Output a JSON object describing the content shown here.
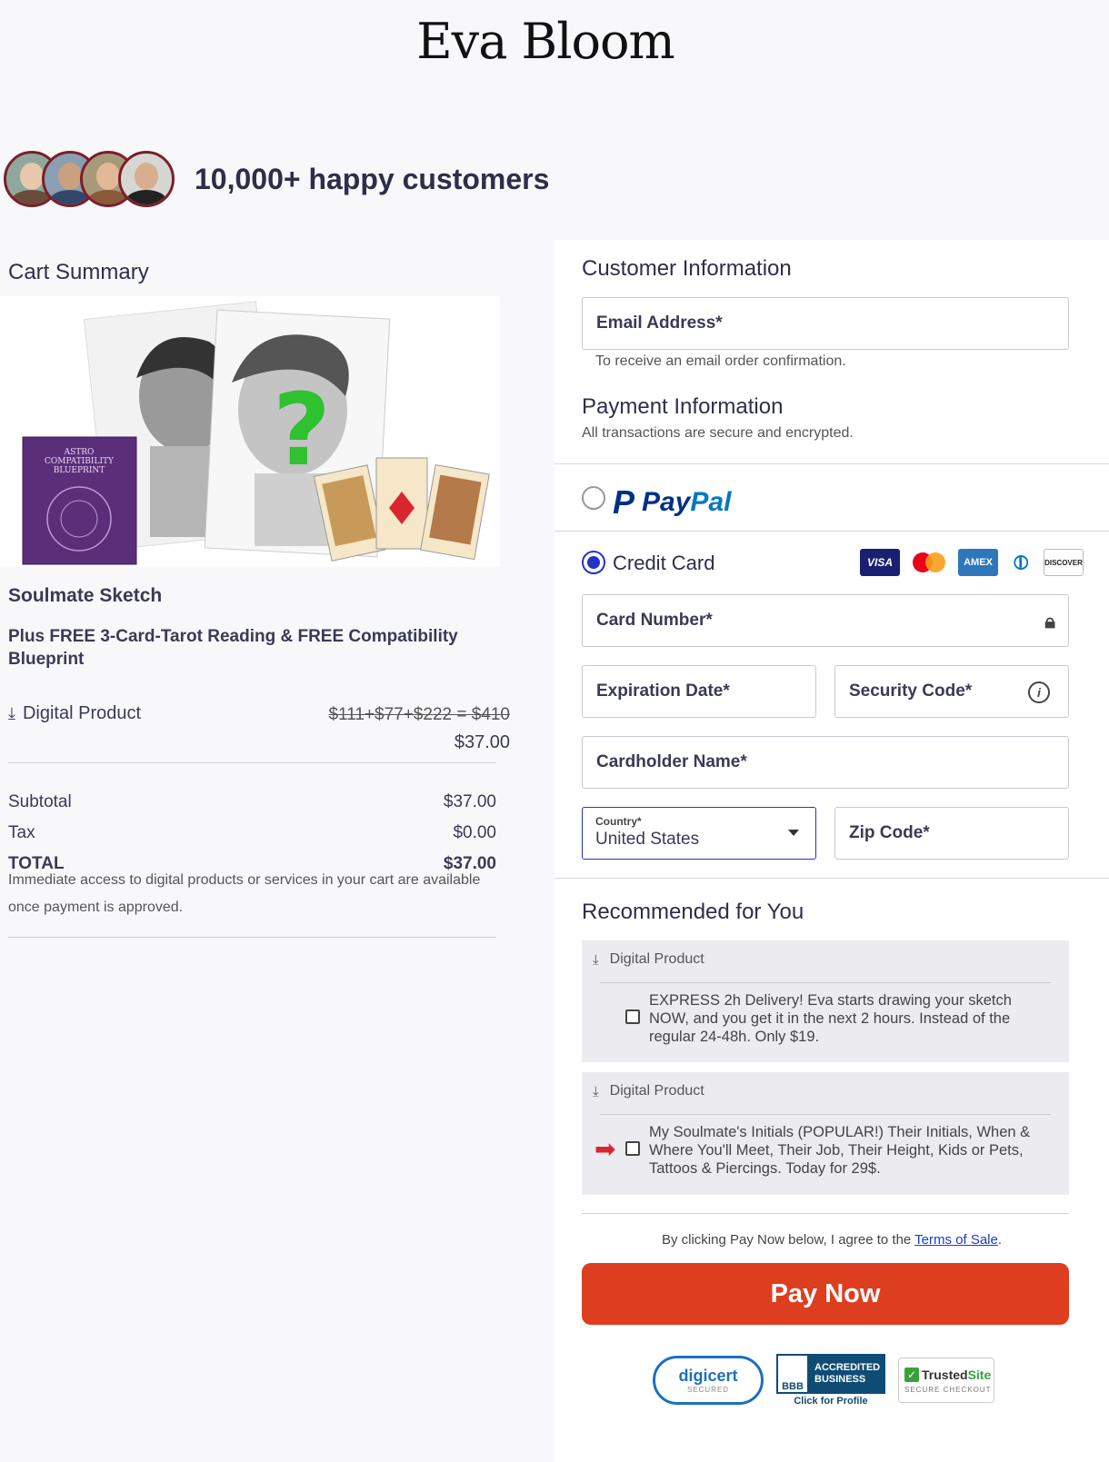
{
  "brand": {
    "logo_text": "Eva Bloom"
  },
  "social_proof": {
    "text": "10,000+ happy customers",
    "avatar_count": 4
  },
  "cart": {
    "title": "Cart Summary",
    "product": {
      "name": "Soulmate Sketch",
      "subtitle": "Plus FREE 3-Card-Tarot Reading & FREE Compatibility Blueprint",
      "type_label": "Digital Product",
      "original_price": "$111+$77+$222 = $410",
      "price": "$37.00",
      "image_book_text": "ASTRO COMPATIBILITY BLUEPRINT"
    },
    "subtotal_label": "Subtotal",
    "subtotal_value": "$37.00",
    "tax_label": "Tax",
    "tax_value": "$0.00",
    "total_label": "TOTAL",
    "total_value": "$37.00",
    "note": "Immediate access to digital products or services in your cart are available once payment is approved."
  },
  "customer": {
    "title": "Customer Information",
    "email_placeholder": "Email Address*",
    "email_hint": "To receive an email order confirmation."
  },
  "payment": {
    "title": "Payment Information",
    "subtitle": "All transactions are secure and encrypted.",
    "paypal_pay": "Pay",
    "paypal_pal": "Pal",
    "credit_card_label": "Credit Card",
    "card_brands": [
      "VISA",
      "mastercard",
      "AMEX",
      "diners",
      "DISCOVER"
    ],
    "card_number_placeholder": "Card Number*",
    "expiration_placeholder": "Expiration Date*",
    "security_placeholder": "Security Code*",
    "cardholder_placeholder": "Cardholder Name*",
    "country_label": "Country*",
    "country_value": "United States",
    "zip_placeholder": "Zip Code*",
    "selected_method": "credit-card"
  },
  "recommended": {
    "title": "Recommended for You",
    "items": [
      {
        "type_label": "Digital Product",
        "text": "EXPRESS 2h Delivery! Eva starts drawing your sketch NOW, and you get it in the next 2 hours. Instead of the regular 24-48h. Only $19.",
        "checked": false
      },
      {
        "type_label": "Digital Product",
        "text": "My Soulmate's Initials (POPULAR!) Their Initials, When & Where You'll Meet, Their Job, Their Height, Kids or Pets, Tattoos & Piercings. Today for 29$.",
        "checked": false
      }
    ]
  },
  "checkout": {
    "agree_prefix": "By clicking Pay Now below, I agree to the ",
    "terms_link": "Terms of Sale",
    "agree_suffix": ".",
    "pay_button": "Pay Now"
  },
  "trust_badges": {
    "digicert": "digicert",
    "digicert_sub": "SECURED",
    "bbb_logo": "BBB",
    "bbb_text1": "ACCREDITED",
    "bbb_text2": "BUSINESS",
    "bbb_click": "Click for Profile",
    "trusted_a": "Trusted",
    "trusted_b": "Site",
    "trusted_sub": "SECURE CHECKOUT"
  },
  "colors": {
    "accent": "#2233c8",
    "pay_button": "#dd3e1f",
    "text": "#3a3a55"
  }
}
